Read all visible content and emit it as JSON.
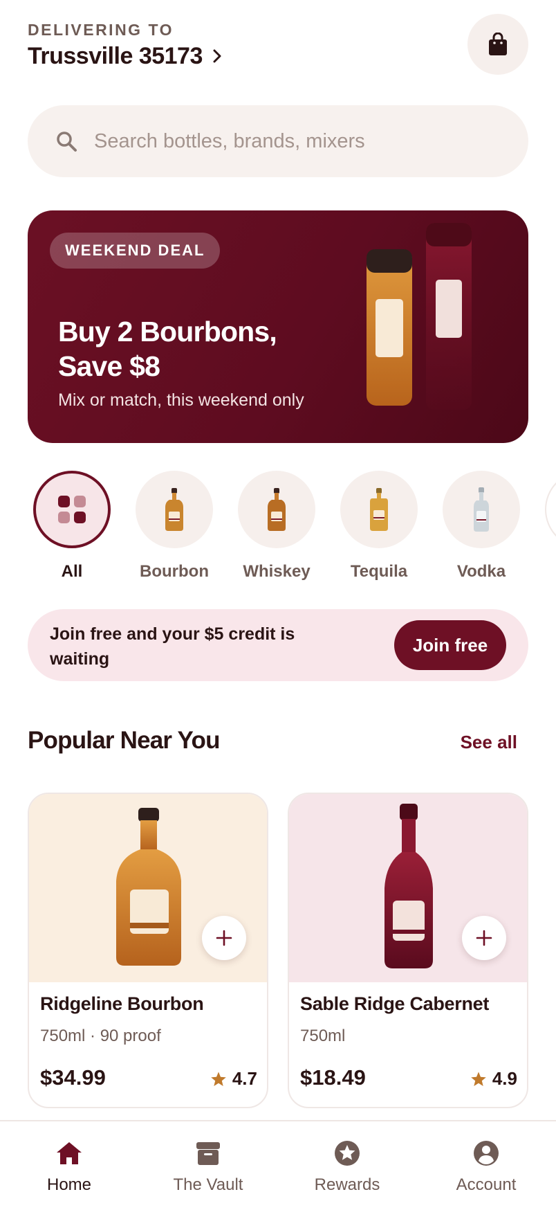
{
  "header": {
    "delivering_label": "DELIVERING TO",
    "location": "Trussville 35173"
  },
  "search": {
    "placeholder": "Search bottles, brands, mixers"
  },
  "promo": {
    "badge": "WEEKEND DEAL",
    "title": "Buy 2 Bourbons, Save $8",
    "subtitle": "Mix or match, this weekend only"
  },
  "categories": [
    {
      "label": "All",
      "selected": true
    },
    {
      "label": "Bourbon",
      "selected": false
    },
    {
      "label": "Whiskey",
      "selected": false
    },
    {
      "label": "Tequila",
      "selected": false
    },
    {
      "label": "Vodka",
      "selected": false
    }
  ],
  "join_banner": {
    "text": "Join free and your $5 credit is waiting",
    "button": "Join free"
  },
  "popular": {
    "title": "Popular Near You",
    "see_all": "See all",
    "products": [
      {
        "name": "Ridgeline Bourbon",
        "meta": "750ml · 90 proof",
        "price": "$34.99",
        "rating": "4.7"
      },
      {
        "name": "Sable Ridge Cabernet",
        "meta": "750ml",
        "price": "$18.49",
        "rating": "4.9"
      }
    ]
  },
  "nav": [
    {
      "label": "Home",
      "icon": "home-icon",
      "active": true
    },
    {
      "label": "The Vault",
      "icon": "archive-icon",
      "active": false
    },
    {
      "label": "Rewards",
      "icon": "star-badge-icon",
      "active": false
    },
    {
      "label": "Account",
      "icon": "user-circle-icon",
      "active": false
    }
  ],
  "colors": {
    "brand": "#6e1025",
    "amber": "#c9852e",
    "star": "#c07a2c",
    "muted_text": "#6e5b55"
  }
}
